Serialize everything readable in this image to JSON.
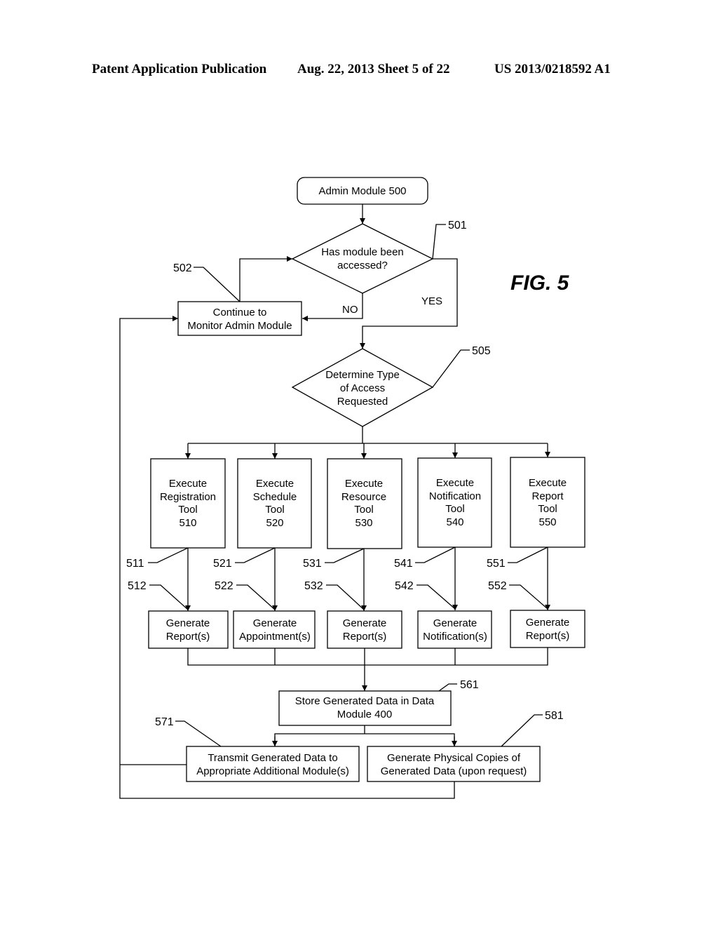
{
  "header": {
    "publication": "Patent Application Publication",
    "date_sheet": "Aug. 22, 2013  Sheet 5 of 22",
    "patent_number": "US 2013/0218592 A1"
  },
  "figure_label": "FIG. 5",
  "nodes": {
    "start": {
      "lines": [
        "Admin Module 500"
      ]
    },
    "decision_accessed": {
      "lines": [
        "Has module been",
        "accessed?"
      ],
      "ref": "501"
    },
    "monitor": {
      "lines": [
        "Continue to",
        "Monitor Admin Module"
      ],
      "ref": "502"
    },
    "determine_type": {
      "lines": [
        "Determine Type",
        "of Access",
        "Requested"
      ],
      "ref": "505"
    },
    "tools": [
      {
        "lines": [
          "Execute",
          "Registration",
          "Tool",
          "510"
        ],
        "ref_line": "511",
        "ref_arrow": "512",
        "output": [
          "Generate",
          "Report(s)"
        ]
      },
      {
        "lines": [
          "Execute",
          "Schedule",
          "Tool",
          "520"
        ],
        "ref_line": "521",
        "ref_arrow": "522",
        "output": [
          "Generate",
          "Appointment(s)"
        ]
      },
      {
        "lines": [
          "Execute",
          "Resource",
          "Tool",
          "530"
        ],
        "ref_line": "531",
        "ref_arrow": "532",
        "output": [
          "Generate",
          "Report(s)"
        ]
      },
      {
        "lines": [
          "Execute",
          "Notification",
          "Tool",
          "540"
        ],
        "ref_line": "541",
        "ref_arrow": "542",
        "output": [
          "Generate",
          "Notification(s)"
        ]
      },
      {
        "lines": [
          "Execute",
          "Report",
          "Tool",
          "550"
        ],
        "ref_line": "551",
        "ref_arrow": "552",
        "output": [
          "Generate",
          "Report(s)"
        ]
      }
    ],
    "store": {
      "lines": [
        "Store Generated Data in Data",
        "Module 400"
      ],
      "ref": "561"
    },
    "transmit": {
      "lines": [
        "Transmit Generated Data to",
        "Appropriate Additional Module(s)"
      ],
      "ref": "571"
    },
    "physical": {
      "lines": [
        "Generate Physical Copies of",
        "Generated Data (upon request)"
      ],
      "ref": "581"
    }
  },
  "edge_labels": {
    "no": "NO",
    "yes": "YES"
  }
}
